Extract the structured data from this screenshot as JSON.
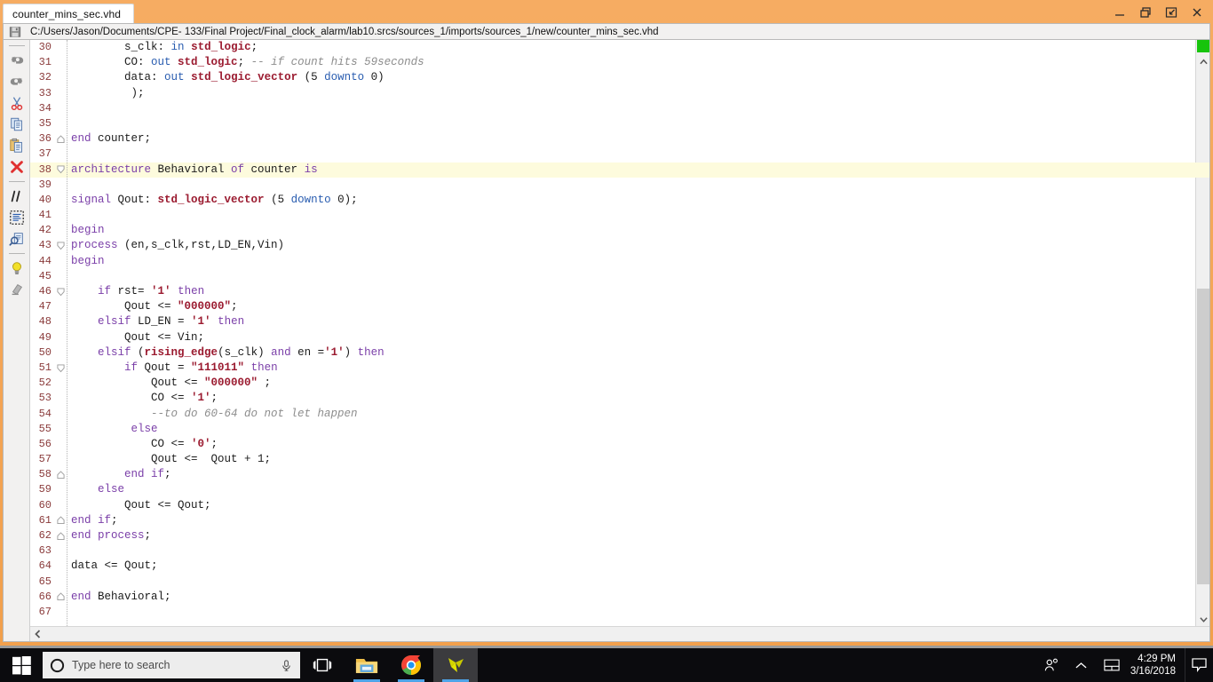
{
  "window": {
    "tab_title": "counter_mins_sec.vhd",
    "file_path": "C:/Users/Jason/Documents/CPE- 133/Final Project/Final_clock_alarm/lab10.srcs/sources_1/imports/sources_1/new/counter_mins_sec.vhd",
    "accent_color": "#f2a04c",
    "controls": [
      {
        "name": "minimize",
        "label": "—"
      },
      {
        "name": "restore",
        "label": "❐"
      },
      {
        "name": "float",
        "label": "↗"
      },
      {
        "name": "close",
        "label": "✕"
      }
    ]
  },
  "toolbar": {
    "items": [
      {
        "name": "undo-icon",
        "title": "Undo"
      },
      {
        "name": "redo-icon",
        "title": "Redo"
      },
      {
        "name": "cut-icon",
        "title": "Cut"
      },
      {
        "name": "copy-icon",
        "title": "Copy"
      },
      {
        "name": "paste-icon",
        "title": "Paste"
      },
      {
        "name": "delete-icon",
        "title": "Delete"
      },
      {
        "name": "comment-icon",
        "title": "Toggle Comment"
      },
      {
        "name": "block-select-icon",
        "title": "Block Selection"
      },
      {
        "name": "find-replace-icon",
        "title": "Find / Replace"
      },
      {
        "name": "lightbulb-icon",
        "title": "Suggestions"
      },
      {
        "name": "eraser-icon",
        "title": "Clear Highlight"
      }
    ]
  },
  "editor": {
    "first_line": 30,
    "highlight_line": 38,
    "health_marker_color": "#17c40c",
    "fold_open_lines": [
      38,
      43,
      46,
      51
    ],
    "fold_close_lines": [
      36,
      58,
      61,
      62,
      66
    ],
    "lines": [
      {
        "n": 30,
        "tokens": [
          [
            "p",
            "        s_clk: "
          ],
          [
            "d",
            "in"
          ],
          [
            "p",
            " "
          ],
          [
            "t",
            "std_logic"
          ],
          [
            "p",
            ";"
          ]
        ]
      },
      {
        "n": 31,
        "tokens": [
          [
            "p",
            "        CO: "
          ],
          [
            "d",
            "out"
          ],
          [
            "p",
            " "
          ],
          [
            "t",
            "std_logic"
          ],
          [
            "p",
            "; "
          ],
          [
            "c",
            "-- if count hits 59seconds"
          ]
        ]
      },
      {
        "n": 32,
        "tokens": [
          [
            "p",
            "        data: "
          ],
          [
            "d",
            "out"
          ],
          [
            "p",
            " "
          ],
          [
            "t",
            "std_logic_vector"
          ],
          [
            "p",
            " (5 "
          ],
          [
            "d",
            "downto"
          ],
          [
            "p",
            " 0)"
          ]
        ]
      },
      {
        "n": 33,
        "tokens": [
          [
            "p",
            "         );"
          ]
        ]
      },
      {
        "n": 34,
        "tokens": []
      },
      {
        "n": 35,
        "tokens": []
      },
      {
        "n": 36,
        "tokens": [
          [
            "k",
            "end"
          ],
          [
            "p",
            " counter;"
          ]
        ]
      },
      {
        "n": 37,
        "tokens": []
      },
      {
        "n": 38,
        "tokens": [
          [
            "k",
            "architecture"
          ],
          [
            "p",
            " Behavioral "
          ],
          [
            "k",
            "of"
          ],
          [
            "p",
            " counter "
          ],
          [
            "k",
            "is"
          ]
        ]
      },
      {
        "n": 39,
        "tokens": []
      },
      {
        "n": 40,
        "tokens": [
          [
            "k",
            "signal"
          ],
          [
            "p",
            " Qout: "
          ],
          [
            "t",
            "std_logic_vector"
          ],
          [
            "p",
            " (5 "
          ],
          [
            "d",
            "downto"
          ],
          [
            "p",
            " 0);"
          ]
        ]
      },
      {
        "n": 41,
        "tokens": []
      },
      {
        "n": 42,
        "tokens": [
          [
            "k",
            "begin"
          ]
        ]
      },
      {
        "n": 43,
        "tokens": [
          [
            "k",
            "process"
          ],
          [
            "p",
            " (en,s_clk,rst,LD_EN,Vin)"
          ]
        ]
      },
      {
        "n": 44,
        "tokens": [
          [
            "k",
            "begin"
          ]
        ]
      },
      {
        "n": 45,
        "tokens": []
      },
      {
        "n": 46,
        "tokens": [
          [
            "p",
            "    "
          ],
          [
            "k",
            "if"
          ],
          [
            "p",
            " rst= "
          ],
          [
            "t",
            "'1'"
          ],
          [
            "p",
            " "
          ],
          [
            "k",
            "then"
          ]
        ]
      },
      {
        "n": 47,
        "tokens": [
          [
            "p",
            "        Qout <= "
          ],
          [
            "t",
            "\"000000\""
          ],
          [
            "p",
            ";"
          ]
        ]
      },
      {
        "n": 48,
        "tokens": [
          [
            "p",
            "    "
          ],
          [
            "k",
            "elsif"
          ],
          [
            "p",
            " LD_EN = "
          ],
          [
            "t",
            "'1'"
          ],
          [
            "p",
            " "
          ],
          [
            "k",
            "then"
          ]
        ]
      },
      {
        "n": 49,
        "tokens": [
          [
            "p",
            "        Qout <= Vin;"
          ]
        ]
      },
      {
        "n": 50,
        "tokens": [
          [
            "p",
            "    "
          ],
          [
            "k",
            "elsif"
          ],
          [
            "p",
            " ("
          ],
          [
            "t",
            "rising_edge"
          ],
          [
            "p",
            "(s_clk) "
          ],
          [
            "k",
            "and"
          ],
          [
            "p",
            " en ="
          ],
          [
            "t",
            "'1'"
          ],
          [
            "p",
            ") "
          ],
          [
            "k",
            "then"
          ]
        ]
      },
      {
        "n": 51,
        "tokens": [
          [
            "p",
            "        "
          ],
          [
            "k",
            "if"
          ],
          [
            "p",
            " Qout = "
          ],
          [
            "t",
            "\"111011\""
          ],
          [
            "p",
            " "
          ],
          [
            "k",
            "then"
          ]
        ]
      },
      {
        "n": 52,
        "tokens": [
          [
            "p",
            "            Qout <= "
          ],
          [
            "t",
            "\"000000\""
          ],
          [
            "p",
            " ;"
          ]
        ]
      },
      {
        "n": 53,
        "tokens": [
          [
            "p",
            "            CO <= "
          ],
          [
            "t",
            "'1'"
          ],
          [
            "p",
            ";"
          ]
        ]
      },
      {
        "n": 54,
        "tokens": [
          [
            "p",
            "            "
          ],
          [
            "c",
            "--to do 60-64 do not let happen"
          ]
        ]
      },
      {
        "n": 55,
        "tokens": [
          [
            "p",
            "         "
          ],
          [
            "k",
            "else"
          ]
        ]
      },
      {
        "n": 56,
        "tokens": [
          [
            "p",
            "            CO <= "
          ],
          [
            "t",
            "'0'"
          ],
          [
            "p",
            ";"
          ]
        ]
      },
      {
        "n": 57,
        "tokens": [
          [
            "p",
            "            Qout <=  Qout + 1;"
          ]
        ]
      },
      {
        "n": 58,
        "tokens": [
          [
            "p",
            "        "
          ],
          [
            "k",
            "end if"
          ],
          [
            "p",
            ";"
          ]
        ]
      },
      {
        "n": 59,
        "tokens": [
          [
            "p",
            "    "
          ],
          [
            "k",
            "else"
          ]
        ]
      },
      {
        "n": 60,
        "tokens": [
          [
            "p",
            "        Qout <= Qout;"
          ]
        ]
      },
      {
        "n": 61,
        "tokens": [
          [
            "k",
            "end if"
          ],
          [
            "p",
            ";"
          ]
        ]
      },
      {
        "n": 62,
        "tokens": [
          [
            "k",
            "end"
          ],
          [
            "p",
            " "
          ],
          [
            "k",
            "process"
          ],
          [
            "p",
            ";"
          ]
        ]
      },
      {
        "n": 63,
        "tokens": []
      },
      {
        "n": 64,
        "tokens": [
          [
            "p",
            "data <= Qout;"
          ]
        ]
      },
      {
        "n": 65,
        "tokens": []
      },
      {
        "n": 66,
        "tokens": [
          [
            "k",
            "end"
          ],
          [
            "p",
            " Behavioral;"
          ]
        ]
      },
      {
        "n": 67,
        "tokens": []
      }
    ]
  },
  "scrollbars": {
    "vertical": {
      "up_arrow": "⌃",
      "down_arrow": "⌄",
      "thumb_top_pct": 42,
      "thumb_height_pct": 53
    },
    "horizontal": {
      "left_arrow": "‹"
    }
  },
  "taskbar": {
    "start": "start-icon",
    "search_placeholder": "Type here to search",
    "cortana": "cortana-circle-icon",
    "mic": "microphone-icon",
    "apps": [
      {
        "name": "task-view",
        "running": false,
        "active": false
      },
      {
        "name": "file-explorer",
        "running": true,
        "active": false
      },
      {
        "name": "google-chrome",
        "running": true,
        "active": false
      },
      {
        "name": "vivado",
        "running": true,
        "active": true
      }
    ],
    "tray": [
      {
        "name": "people-icon"
      },
      {
        "name": "show-hidden-icons-chevron"
      },
      {
        "name": "touchpad-icon"
      }
    ],
    "time": "4:29 PM",
    "date": "3/16/2018",
    "action_center": "action-center-icon"
  }
}
